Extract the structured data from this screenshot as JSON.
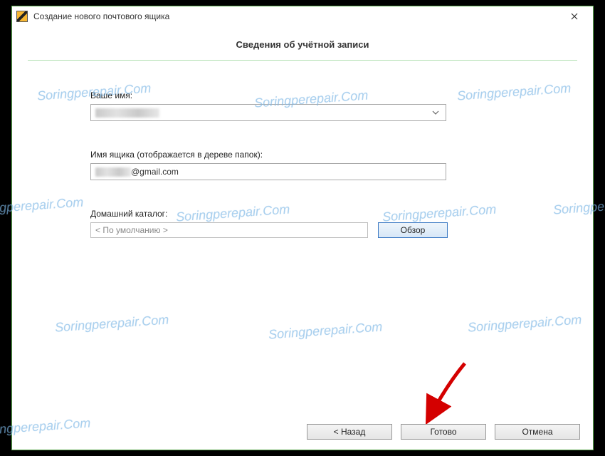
{
  "window": {
    "title": "Создание нового почтового ящика"
  },
  "header": {
    "title": "Сведения об учётной записи"
  },
  "fields": {
    "name_label": "Ваше имя:",
    "name_value": "██████████",
    "mailbox_label": "Имя ящика (отображается в дереве папок):",
    "mailbox_prefix": "██████",
    "mailbox_suffix": "@gmail.com",
    "catalog_label": "Домашний каталог:",
    "catalog_value": "< По умолчанию >",
    "browse_label": "Обзор"
  },
  "buttons": {
    "back": "<  Назад",
    "finish": "Готово",
    "cancel": "Отмена"
  },
  "watermark": "Soringperepair.Com"
}
